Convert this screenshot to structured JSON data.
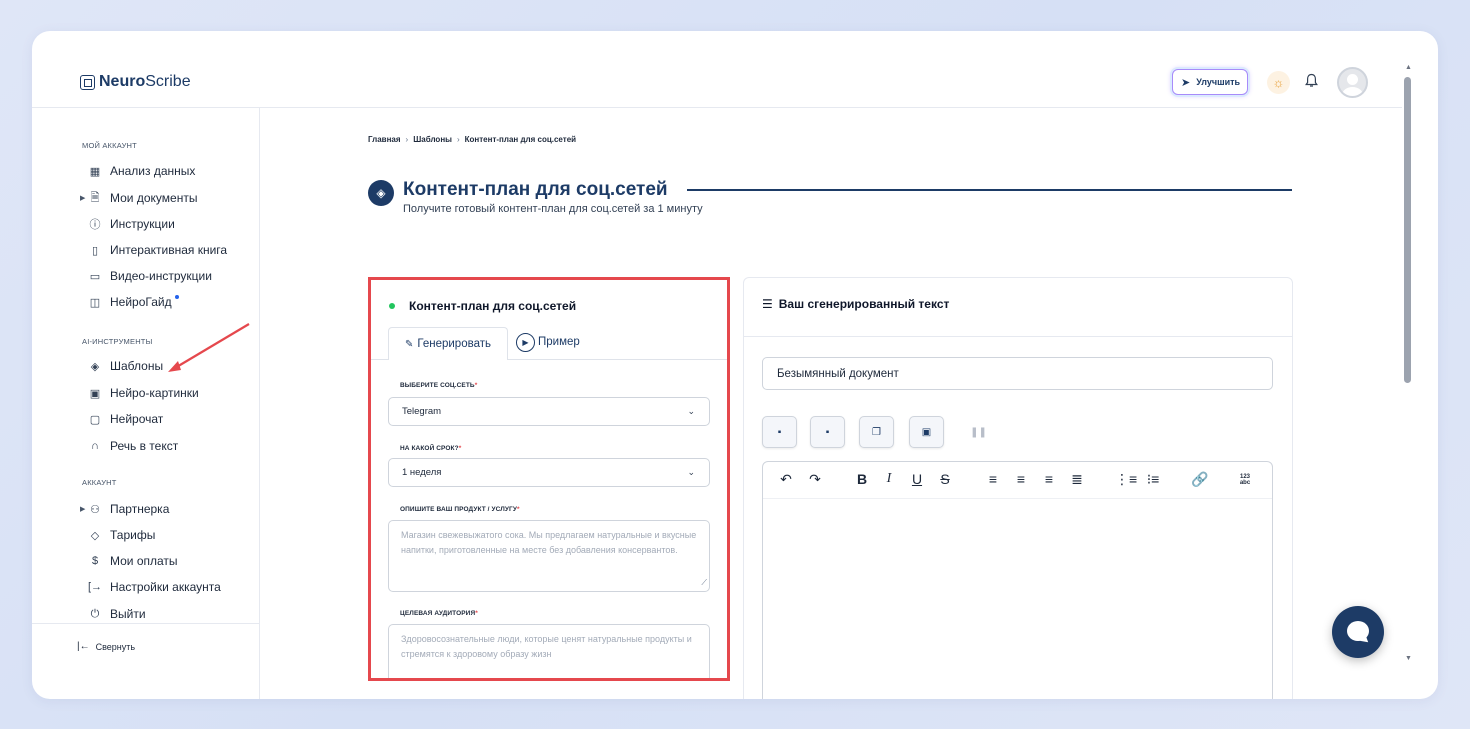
{
  "logo": {
    "brand_bold": "Neuro",
    "brand_rest": "Scribe"
  },
  "header": {
    "upgrade_label": "Улучшить",
    "sun_icon": "☀",
    "bell_icon": "🔔"
  },
  "sidebar": {
    "section_account": "МОЙ АККАУНТ",
    "items_account": [
      {
        "label": "Анализ данных",
        "icon": "grid-icon"
      },
      {
        "label": "Мои документы",
        "icon": "document-icon"
      },
      {
        "label": "Инструкции",
        "icon": "help-circle-icon"
      },
      {
        "label": "Интерактивная книга",
        "icon": "book-icon"
      },
      {
        "label": "Видео-инструкции",
        "icon": "video-icon"
      },
      {
        "label": "НейроГайд",
        "icon": "layout-icon"
      }
    ],
    "section_ai": "AI-ИНСТРУМЕНТЫ",
    "items_ai": [
      {
        "label": "Шаблоны",
        "icon": "layers-icon"
      },
      {
        "label": "Нейро-картинки",
        "icon": "image-icon"
      },
      {
        "label": "Нейрочат",
        "icon": "chat-icon"
      },
      {
        "label": "Речь в текст",
        "icon": "headphones-icon"
      }
    ],
    "section_acc2": "АККАУНТ",
    "items_acc2": [
      {
        "label": "Партнерка",
        "icon": "users-icon"
      },
      {
        "label": "Тарифы",
        "icon": "tag-icon"
      },
      {
        "label": "Мои оплаты",
        "icon": "dollar-icon"
      },
      {
        "label": "Настройки аккаунта",
        "icon": "login-icon"
      },
      {
        "label": "Выйти",
        "icon": "power-icon"
      }
    ],
    "collapse_label": "Свернуть"
  },
  "breadcrumb": {
    "home": "Главная",
    "templates": "Шаблоны",
    "current": "Контент-план для соц.сетей"
  },
  "page": {
    "title": "Контент-план для соц.сетей",
    "subtitle": "Получите готовый контент-план для соц.сетей за 1 минуту"
  },
  "form": {
    "card_title": "Контент-план для соц.сетей",
    "tab_generate": "Генерировать",
    "tab_example": "Пример",
    "social_label": "ВЫБЕРИТЕ СОЦ.СЕТЬ",
    "social_value": "Telegram",
    "period_label": "НА КАКОЙ СРОК?",
    "period_value": "1 неделя",
    "product_label": "ОПИШИТЕ ВАШ ПРОДУКТ / УСЛУГУ",
    "product_placeholder": "Магазин свежевыжатого сока. Мы предлагаем натуральные и вкусные напитки, приготовленные на месте без добавления консервантов.",
    "audience_label": "ЦЕЛЕВАЯ АУДИТОРИЯ",
    "audience_placeholder": "Здоровосознательные люди, которые ценят натуральные продукты и стремятся к здоровому образу жизн",
    "required_mark": "*"
  },
  "result": {
    "title": "Ваш сгенерированный текст",
    "doc_name": "Безымянный документ",
    "editor_numlist_label": "123 abc"
  },
  "colors": {
    "brand": "#1d3b66",
    "highlight": "#e5484d",
    "status_green": "#22c55e"
  }
}
